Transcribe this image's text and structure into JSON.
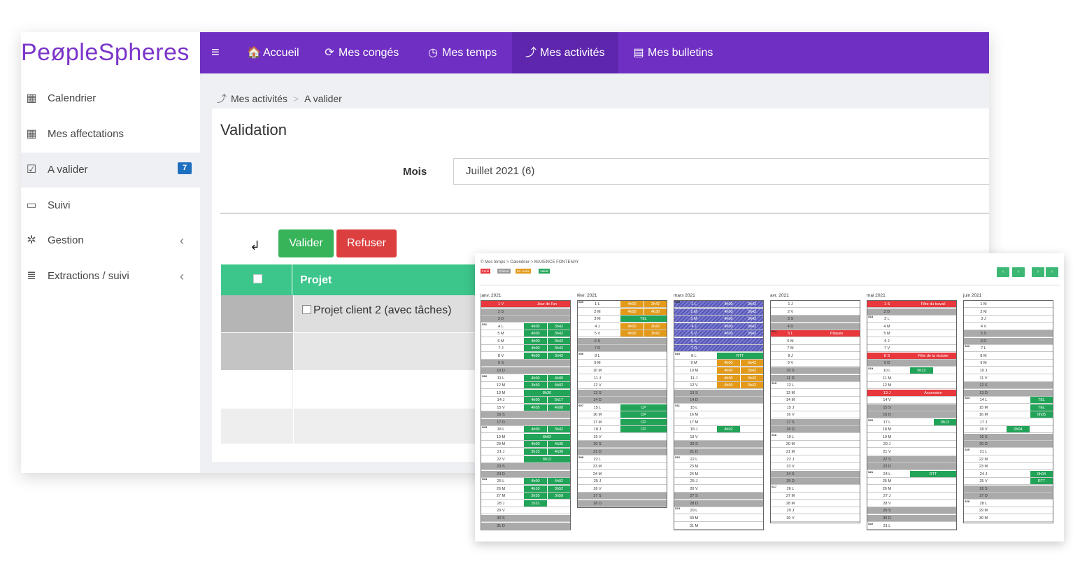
{
  "brand": {
    "logo_text": "PeøpleSpheres"
  },
  "topnav": {
    "items": [
      {
        "label": "Accueil",
        "icon": "home-icon",
        "glyph": "🏠"
      },
      {
        "label": "Mes congés",
        "icon": "refresh-icon",
        "glyph": "⟳"
      },
      {
        "label": "Mes temps",
        "icon": "clock-icon",
        "glyph": "◷"
      },
      {
        "label": "Mes activités",
        "icon": "chart-line-icon",
        "glyph": "⤴"
      },
      {
        "label": "Mes bulletins",
        "icon": "files-icon",
        "glyph": "▤"
      }
    ],
    "menu_glyph": "≡"
  },
  "sidebar": {
    "items": [
      {
        "label": "Calendrier",
        "icon": "calendar-icon",
        "glyph": "▦"
      },
      {
        "label": "Mes affectations",
        "icon": "calendar-icon",
        "glyph": "▦"
      },
      {
        "label": "A valider",
        "icon": "check-square-icon",
        "glyph": "☑",
        "badge": "7"
      },
      {
        "label": "Suivi",
        "icon": "calendar-empty-icon",
        "glyph": "▭"
      },
      {
        "label": "Gestion",
        "icon": "gear-icon",
        "glyph": "✲"
      },
      {
        "label": "Extractions / suivi",
        "icon": "database-icon",
        "glyph": "≣"
      }
    ],
    "chevron": "‹"
  },
  "breadcrumb": {
    "items": [
      "Mes activités",
      "A valider"
    ],
    "separator": ">",
    "glyph": "⤴"
  },
  "page": {
    "title": "Validation",
    "mois_label": "Mois",
    "mois_value": "Juillet 2021 (6)",
    "arrow_glyph": "↲",
    "valider_label": "Valider",
    "refuser_label": "Refuser",
    "table_header": "Projet",
    "rows": [
      {
        "label": "Projet client 2 (avec tâches)"
      }
    ]
  },
  "calendar": {
    "breadcrumb": "©  Mes temps   >   Calendrier   >   MAXENCE FONTENAY",
    "legend": [
      {
        "label": "Férié",
        "color": "#e8373d"
      },
      {
        "label": "Chômé",
        "color": "#9a9a9a"
      },
      {
        "label": "En cours",
        "color": "#e39a1a"
      },
      {
        "label": "Validé",
        "color": "#22a458"
      }
    ],
    "nav": [
      "‹",
      "‹",
      "›",
      "›"
    ],
    "months": [
      {
        "name": "janv. 2021",
        "days": [
          {
            "d": "1 V",
            "hol": true,
            "w": "Jour de l'an"
          },
          {
            "d": "2 S",
            "we": true
          },
          {
            "d": "3 D",
            "we": true
          },
          {
            "d": "4 L",
            "wk": "S01",
            "a": "4h00",
            "b": "3h42",
            "c": "g"
          },
          {
            "d": "5 M",
            "a": "4h00",
            "b": "3h42",
            "c": "g"
          },
          {
            "d": "6 M",
            "a": "4h00",
            "b": "3h42",
            "c": "g"
          },
          {
            "d": "7 J",
            "a": "4h00",
            "b": "3h42",
            "c": "g"
          },
          {
            "d": "8 V",
            "a": "4h00",
            "b": "3h42",
            "c": "g"
          },
          {
            "d": "9 S",
            "we": true
          },
          {
            "d": "10 D",
            "we": true
          },
          {
            "d": "11 L",
            "wk": "S02",
            "a": "4h00",
            "b": "4h00",
            "c": "g"
          },
          {
            "d": "12 M",
            "a": "3h50",
            "b": "4h02",
            "c": "g"
          },
          {
            "d": "13 M",
            "w": "8h30",
            "c": "g"
          },
          {
            "d": "14 J",
            "a": "4h00",
            "b": "5h17",
            "c": "g"
          },
          {
            "d": "15 V",
            "a": "4h05",
            "b": "4h08",
            "c": "g"
          },
          {
            "d": "16 S",
            "we": true
          },
          {
            "d": "17 D",
            "we": true
          },
          {
            "d": "18 L",
            "wk": "S03",
            "a": "4h00",
            "b": "3h42",
            "c": "g"
          },
          {
            "d": "19 M",
            "w": "8h02",
            "c": "g"
          },
          {
            "d": "20 M",
            "a": "4h00",
            "b": "4h35",
            "c": "g"
          },
          {
            "d": "21 J",
            "a": "3h15",
            "b": "4h30",
            "c": "g"
          },
          {
            "d": "22 V",
            "w": "8h12",
            "c": "g"
          },
          {
            "d": "23 S",
            "we": true
          },
          {
            "d": "24 D",
            "we": true
          },
          {
            "d": "25 L",
            "wk": "S04",
            "a": "4h00",
            "b": "4h02",
            "c": "g"
          },
          {
            "d": "26 M",
            "a": "4h10",
            "b": "3h52",
            "c": "g"
          },
          {
            "d": "27 M",
            "a": "3h55",
            "b": "3h58",
            "c": "g"
          },
          {
            "d": "28 J",
            "a": "1h31",
            "c": "g"
          },
          {
            "d": "29 V"
          },
          {
            "d": "30 S",
            "we": true
          },
          {
            "d": "31 D",
            "we": true
          }
        ]
      },
      {
        "name": "févr. 2021",
        "days": [
          {
            "d": "1 L",
            "wk": "S05",
            "a": "4h00",
            "b": "3h42",
            "c": "o"
          },
          {
            "d": "2 M",
            "a": "4h00",
            "b": "4h30",
            "c": "o"
          },
          {
            "d": "3 M",
            "w": "TEL",
            "c": "g"
          },
          {
            "d": "4 J",
            "a": "4h00",
            "b": "3h42",
            "c": "o"
          },
          {
            "d": "5 V",
            "a": "4h00",
            "b": "3h42",
            "c": "o"
          },
          {
            "d": "6 S",
            "we": true
          },
          {
            "d": "7 D",
            "we": true
          },
          {
            "d": "8 L",
            "wk": "S06"
          },
          {
            "d": "9 M"
          },
          {
            "d": "10 M"
          },
          {
            "d": "11 J"
          },
          {
            "d": "12 V"
          },
          {
            "d": "13 S",
            "we": true
          },
          {
            "d": "14 D",
            "we": true
          },
          {
            "d": "15 L",
            "wk": "S07",
            "w": "CP",
            "c": "g"
          },
          {
            "d": "16 M",
            "w": "CP",
            "c": "g"
          },
          {
            "d": "17 M",
            "w": "CP",
            "c": "g"
          },
          {
            "d": "18 J",
            "w": "CP",
            "c": "g"
          },
          {
            "d": "19 V"
          },
          {
            "d": "20 S",
            "we": true
          },
          {
            "d": "21 D",
            "we": true
          },
          {
            "d": "22 L",
            "wk": "S08"
          },
          {
            "d": "23 M"
          },
          {
            "d": "24 M"
          },
          {
            "d": "25 J"
          },
          {
            "d": "26 V"
          },
          {
            "d": "27 S",
            "we": true
          },
          {
            "d": "28 D",
            "we": true
          }
        ]
      },
      {
        "name": "mars 2021",
        "days": [
          {
            "d": "1 L",
            "wk": "S09",
            "hatch": true,
            "a": "4h00",
            "b": "3h42"
          },
          {
            "d": "2 M",
            "hatch": true,
            "a": "4h00",
            "b": "3h42"
          },
          {
            "d": "3 M",
            "hatch": true,
            "a": "4h00",
            "b": "3h42"
          },
          {
            "d": "4 J",
            "hatch": true,
            "a": "4h00",
            "b": "3h42"
          },
          {
            "d": "5 V",
            "hatch": true,
            "a": "4h00",
            "b": "3h42"
          },
          {
            "d": "6 S",
            "hatch": true
          },
          {
            "d": "7 D",
            "hatch": true
          },
          {
            "d": "8 L",
            "wk": "S10",
            "w": "RTT",
            "c": "g"
          },
          {
            "d": "9 M",
            "a": "4h00",
            "b": "3h42",
            "c": "o"
          },
          {
            "d": "10 M",
            "a": "4h00",
            "b": "3h42",
            "c": "o"
          },
          {
            "d": "11 J",
            "a": "4h00",
            "b": "3h42",
            "c": "o"
          },
          {
            "d": "12 V",
            "a": "4h00",
            "b": "3h42",
            "c": "o"
          },
          {
            "d": "13 S",
            "we": true
          },
          {
            "d": "14 D",
            "we": true
          },
          {
            "d": "15 L",
            "wk": "S11"
          },
          {
            "d": "16 M"
          },
          {
            "d": "17 M"
          },
          {
            "d": "18 J",
            "a": "4h02",
            "c": "g"
          },
          {
            "d": "19 V"
          },
          {
            "d": "20 S",
            "we": true
          },
          {
            "d": "21 D",
            "we": true
          },
          {
            "d": "22 L",
            "wk": "S12"
          },
          {
            "d": "23 M"
          },
          {
            "d": "24 M"
          },
          {
            "d": "25 J"
          },
          {
            "d": "26 V"
          },
          {
            "d": "27 S",
            "we": true
          },
          {
            "d": "28 D",
            "we": true
          },
          {
            "d": "29 L",
            "wk": "S13"
          },
          {
            "d": "30 M"
          },
          {
            "d": "31 M"
          }
        ]
      },
      {
        "name": "avr. 2021",
        "days": [
          {
            "d": "1 J"
          },
          {
            "d": "2 V"
          },
          {
            "d": "3 S",
            "we": true
          },
          {
            "d": "4 D",
            "we": true
          },
          {
            "d": "5 L",
            "wk": "S14",
            "hol": true,
            "w": "Pâques"
          },
          {
            "d": "6 M"
          },
          {
            "d": "7 M"
          },
          {
            "d": "8 J"
          },
          {
            "d": "9 V"
          },
          {
            "d": "10 S",
            "we": true
          },
          {
            "d": "11 D",
            "we": true
          },
          {
            "d": "12 L",
            "wk": "S15"
          },
          {
            "d": "13 M"
          },
          {
            "d": "14 M"
          },
          {
            "d": "15 J"
          },
          {
            "d": "16 V"
          },
          {
            "d": "17 S",
            "we": true
          },
          {
            "d": "18 D",
            "we": true
          },
          {
            "d": "19 L",
            "wk": "S16"
          },
          {
            "d": "20 M"
          },
          {
            "d": "21 M"
          },
          {
            "d": "22 J"
          },
          {
            "d": "23 V"
          },
          {
            "d": "24 S",
            "we": true
          },
          {
            "d": "25 D",
            "we": true
          },
          {
            "d": "26 L",
            "wk": "S17"
          },
          {
            "d": "27 M"
          },
          {
            "d": "28 M"
          },
          {
            "d": "29 J"
          },
          {
            "d": "30 V"
          }
        ]
      },
      {
        "name": "mai 2021",
        "days": [
          {
            "d": "1 S",
            "hol": true,
            "w": "Fête du travail"
          },
          {
            "d": "2 D",
            "we": true
          },
          {
            "d": "3 L",
            "wk": "S18"
          },
          {
            "d": "4 M"
          },
          {
            "d": "5 M"
          },
          {
            "d": "6 J"
          },
          {
            "d": "7 V"
          },
          {
            "d": "8 S",
            "hol": true,
            "w": "Fête de la victoire"
          },
          {
            "d": "9 D",
            "we": true
          },
          {
            "d": "10 L",
            "wk": "S19",
            "a": "0h12",
            "c": "g"
          },
          {
            "d": "11 M"
          },
          {
            "d": "12 M"
          },
          {
            "d": "13 J",
            "hol": true,
            "w": "Ascension"
          },
          {
            "d": "14 V"
          },
          {
            "d": "15 S",
            "we": true
          },
          {
            "d": "16 D",
            "we": true
          },
          {
            "d": "17 L",
            "wk": "S20",
            "b": "0h12",
            "c": "g"
          },
          {
            "d": "18 M"
          },
          {
            "d": "19 M"
          },
          {
            "d": "20 J"
          },
          {
            "d": "21 V"
          },
          {
            "d": "22 S",
            "we": true
          },
          {
            "d": "23 D",
            "we": true
          },
          {
            "d": "24 L",
            "wk": "S21",
            "w": "RTT",
            "c": "g"
          },
          {
            "d": "25 M"
          },
          {
            "d": "26 M"
          },
          {
            "d": "27 J"
          },
          {
            "d": "28 V"
          },
          {
            "d": "29 S",
            "we": true
          },
          {
            "d": "30 D",
            "we": true
          },
          {
            "d": "31 L",
            "wk": "S22"
          }
        ]
      },
      {
        "name": "juin 2021",
        "days": [
          {
            "d": "1 M"
          },
          {
            "d": "2 M"
          },
          {
            "d": "3 J"
          },
          {
            "d": "4 V"
          },
          {
            "d": "5 S",
            "we": true
          },
          {
            "d": "6 D",
            "we": true
          },
          {
            "d": "7 L",
            "wk": "S23"
          },
          {
            "d": "8 M"
          },
          {
            "d": "9 M"
          },
          {
            "d": "10 J"
          },
          {
            "d": "11 V"
          },
          {
            "d": "12 S",
            "we": true
          },
          {
            "d": "13 D",
            "we": true
          },
          {
            "d": "14 L",
            "wk": "S24",
            "b": "TEL",
            "c": "g"
          },
          {
            "d": "15 M",
            "b": "TEL",
            "c": "g"
          },
          {
            "d": "16 M",
            "b": "0h05",
            "c": "g"
          },
          {
            "d": "17 J"
          },
          {
            "d": "18 V",
            "a": "0h04",
            "c": "g"
          },
          {
            "d": "19 S",
            "we": true
          },
          {
            "d": "20 D",
            "we": true
          },
          {
            "d": "21 L",
            "wk": "S25"
          },
          {
            "d": "22 M"
          },
          {
            "d": "23 M"
          },
          {
            "d": "24 J",
            "b": "0h04",
            "c": "g"
          },
          {
            "d": "25 V",
            "b": "RTT",
            "c": "g"
          },
          {
            "d": "26 S",
            "we": true
          },
          {
            "d": "27 D",
            "we": true
          },
          {
            "d": "28 L",
            "wk": "S26"
          },
          {
            "d": "29 M"
          },
          {
            "d": "30 M"
          }
        ]
      }
    ]
  }
}
